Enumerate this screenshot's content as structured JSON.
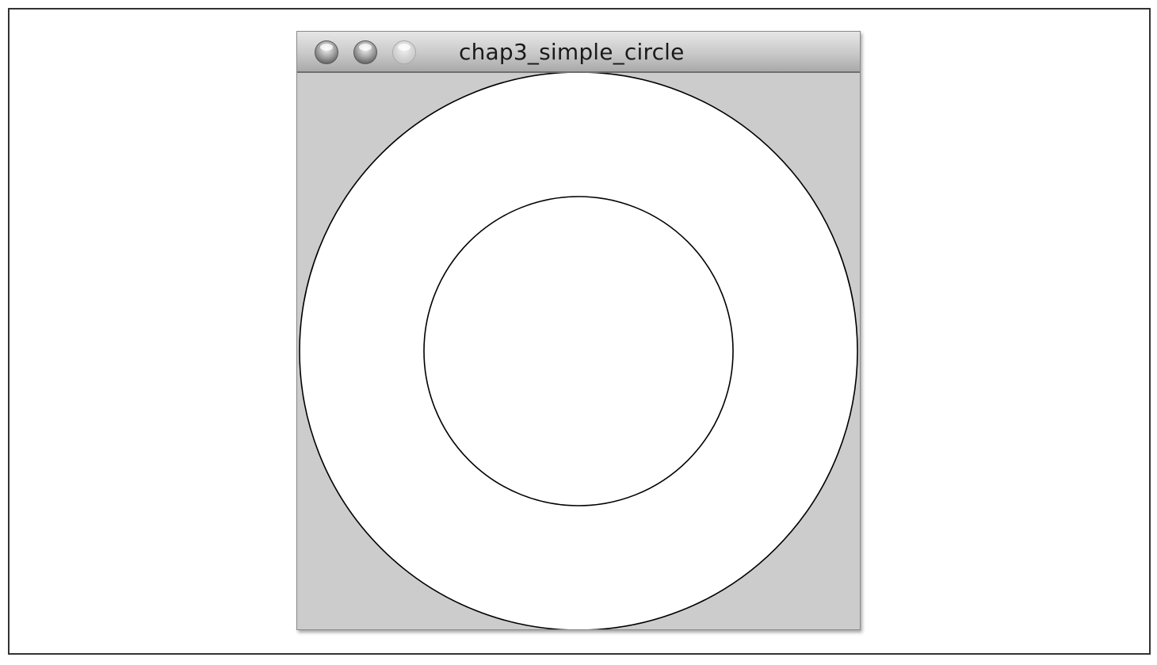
{
  "window": {
    "title": "chap3_simple_circle",
    "buttons": [
      {
        "name": "close",
        "state": "active"
      },
      {
        "name": "minimize",
        "state": "active"
      },
      {
        "name": "zoom",
        "state": "disabled"
      }
    ]
  },
  "canvas": {
    "background_color": "#cccccc",
    "fill_color": "#ffffff",
    "stroke_color": "#000000"
  }
}
